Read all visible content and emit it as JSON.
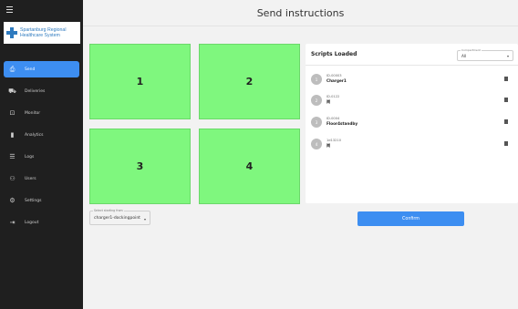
{
  "header": {
    "title": "Send instructions"
  },
  "logo": {
    "line1": "Spartanburg Regional",
    "line2": "Healthcare System"
  },
  "sidebar": {
    "items": [
      {
        "label": "Send",
        "icon": "send-icon",
        "glyph": "⎙",
        "active": true
      },
      {
        "label": "Deliveries",
        "icon": "delivery-icon",
        "glyph": "⛟",
        "active": false
      },
      {
        "label": "Monitor",
        "icon": "monitor-icon",
        "glyph": "⊡",
        "active": false
      },
      {
        "label": "Analytics",
        "icon": "analytics-icon",
        "glyph": "▮",
        "active": false
      },
      {
        "label": "Logs",
        "icon": "logs-icon",
        "glyph": "☰",
        "active": false
      },
      {
        "label": "Users",
        "icon": "users-icon",
        "glyph": "⚇",
        "active": false
      },
      {
        "label": "Settings",
        "icon": "gear-icon",
        "glyph": "⚙",
        "active": false
      },
      {
        "label": "Logout",
        "icon": "logout-icon",
        "glyph": "⇥",
        "active": false
      }
    ]
  },
  "tiles": [
    {
      "label": "1"
    },
    {
      "label": "2"
    },
    {
      "label": "3"
    },
    {
      "label": "4"
    }
  ],
  "scripts_panel": {
    "title": "Scripts Loaded",
    "compartment": {
      "label": "Compartment",
      "value": "All"
    },
    "items": [
      {
        "avatar": "1",
        "id": "ID-00003",
        "name": "Charger1"
      },
      {
        "avatar": "2",
        "id": "ID-0122",
        "name": "岗"
      },
      {
        "avatar": "3",
        "id": "ID-0004",
        "name": "Floor4standby"
      },
      {
        "avatar": "4",
        "id": "1d13210",
        "name": "岗"
      }
    ]
  },
  "start_select": {
    "label": "Select starting from",
    "value": "charger1-dockingpoint"
  },
  "confirm": {
    "label": "Confirm"
  },
  "colors": {
    "accent": "#3d8ef1",
    "tile": "#7ff77e",
    "sidebar": "#1f1f1f"
  }
}
